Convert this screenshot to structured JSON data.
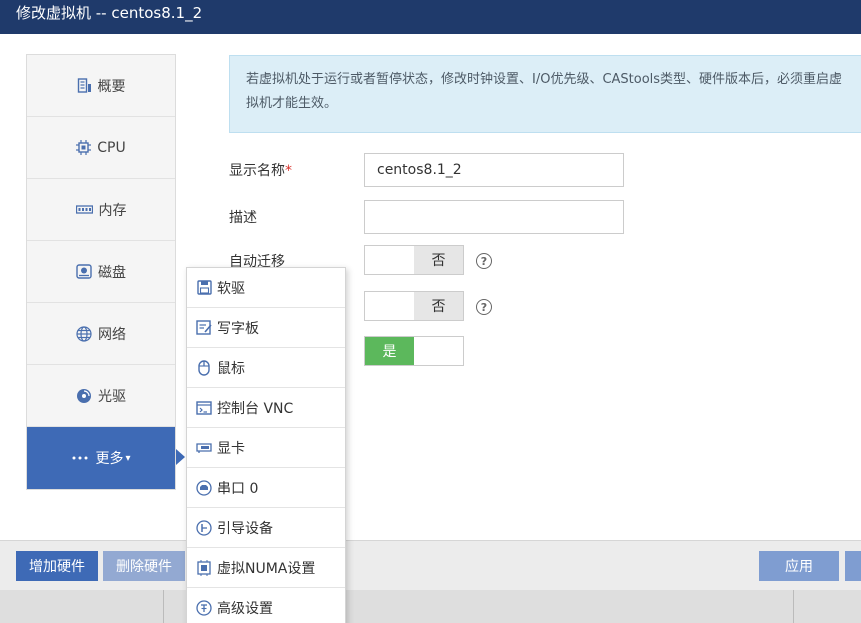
{
  "window": {
    "title": "修改虚拟机 -- centos8.1_2"
  },
  "sidebar": {
    "items": [
      {
        "label": "概要",
        "icon": "summary-icon"
      },
      {
        "label": "CPU",
        "icon": "cpu-icon"
      },
      {
        "label": "内存",
        "icon": "memory-icon"
      },
      {
        "label": "磁盘",
        "icon": "disk-icon"
      },
      {
        "label": "网络",
        "icon": "network-icon"
      },
      {
        "label": "光驱",
        "icon": "cdrom-icon"
      },
      {
        "label": "更多",
        "icon": "more-icon",
        "active": true
      }
    ]
  },
  "notice": {
    "text": "若虚拟机处于运行或者暂停状态，修改时钟设置、I/O优先级、CAStools类型、硬件版本后，必须重启虚拟机才能生效。"
  },
  "form": {
    "display_name_label": "显示名称",
    "required_mark": "*",
    "display_name_value": "centos8.1_2",
    "description_label": "描述",
    "description_value": "",
    "auto_migrate_label": "自动迁移",
    "toggle_no": "否",
    "toggle_yes": "是"
  },
  "dropdown": {
    "items": [
      {
        "label": "软驱",
        "icon": "floppy-icon"
      },
      {
        "label": "写字板",
        "icon": "tablet-icon"
      },
      {
        "label": "鼠标",
        "icon": "mouse-icon"
      },
      {
        "label": "控制台 VNC",
        "icon": "console-icon"
      },
      {
        "label": "显卡",
        "icon": "graphics-card-icon"
      },
      {
        "label": "串口 0",
        "icon": "serial-port-icon"
      },
      {
        "label": "引导设备",
        "icon": "boot-device-icon"
      },
      {
        "label": "虚拟NUMA设置",
        "icon": "numa-icon"
      },
      {
        "label": "高级设置",
        "icon": "advanced-settings-icon"
      }
    ]
  },
  "footer": {
    "add_hardware": "增加硬件",
    "remove_hardware": "删除硬件",
    "apply": "应用"
  },
  "colors": {
    "titlebar": "#1f3a6b",
    "accent": "#3e6ab6",
    "toggle_on": "#5cb85c",
    "notice_bg": "#dceef7"
  }
}
